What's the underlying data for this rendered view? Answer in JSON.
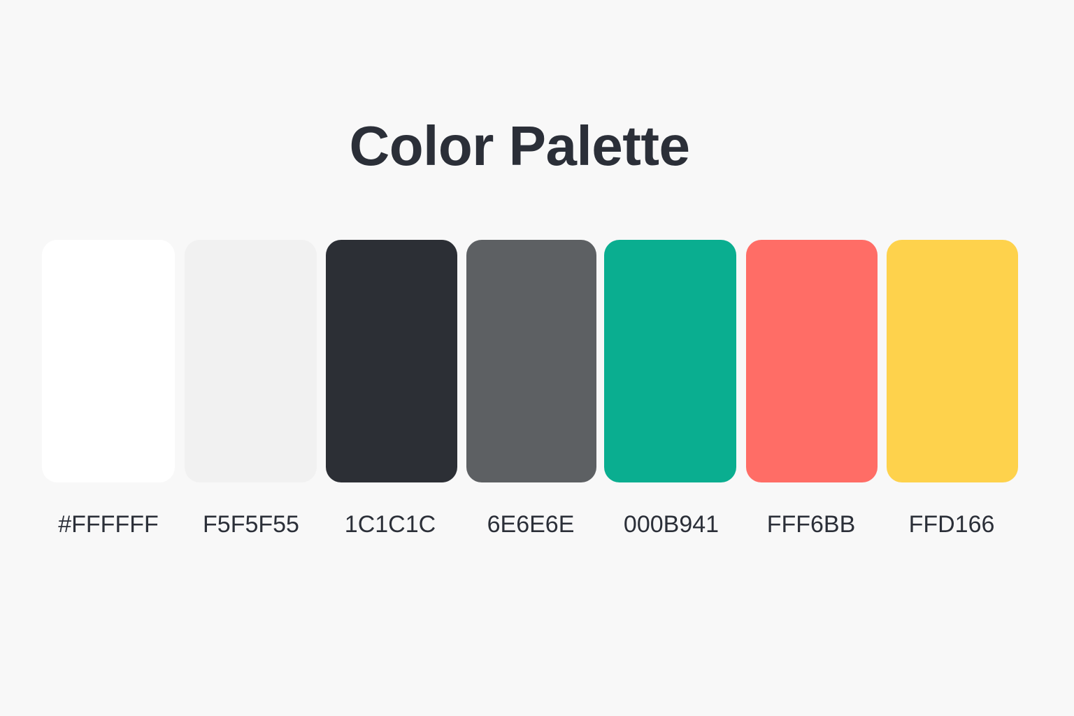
{
  "title": "Color Palette",
  "swatches": [
    {
      "label": "#FFFFFF",
      "color": "#ffffff"
    },
    {
      "label": "F5F5F55",
      "color": "#f1f1f1"
    },
    {
      "label": "1C1C1C",
      "color": "#2c2f35"
    },
    {
      "label": "6E6E6E",
      "color": "#5d6063"
    },
    {
      "label": "000B941",
      "color": "#0aae90"
    },
    {
      "label": "FFF6BB",
      "color": "#ff6d66"
    },
    {
      "label": "FFD166",
      "color": "#fed24c"
    }
  ]
}
